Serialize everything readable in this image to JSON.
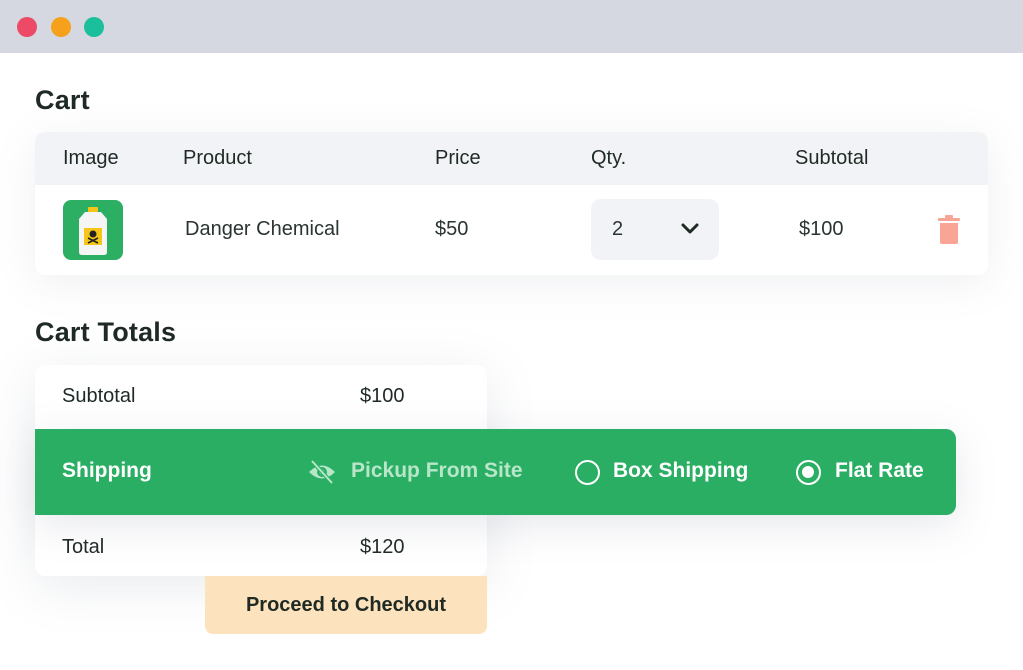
{
  "window": {
    "controls": [
      "close",
      "minimize",
      "maximize"
    ],
    "colors": {
      "close": "#ec4a67",
      "minimize": "#f5a11c",
      "maximize": "#1cbf9b"
    }
  },
  "cart": {
    "title": "Cart",
    "columns": [
      "Image",
      "Product",
      "Price",
      "Qty.",
      "Subtotal"
    ],
    "items": [
      {
        "image_icon": "poison-bottle-icon",
        "product": "Danger Chemical",
        "price": "$50",
        "qty": "2",
        "subtotal": "$100",
        "remove_icon": "trash-icon"
      }
    ]
  },
  "totals": {
    "title": "Cart Totals",
    "subtotal_label": "Subtotal",
    "subtotal_value": "$100",
    "shipping_label": "Shipping",
    "shipping_options": [
      {
        "label": "Pickup From Site",
        "icon": "eye-off-icon",
        "state": "disabled"
      },
      {
        "label": "Box Shipping",
        "icon": "radio-icon",
        "state": "unselected"
      },
      {
        "label": "Flat Rate",
        "icon": "radio-icon",
        "state": "selected"
      }
    ],
    "total_label": "Total",
    "total_value": "$120",
    "checkout_label": "Proceed to Checkout"
  },
  "colors": {
    "accent_green": "#29ae63",
    "checkout_bg": "#fde3bd",
    "trash": "#f8a596",
    "header_bg": "#f2f3f6"
  }
}
